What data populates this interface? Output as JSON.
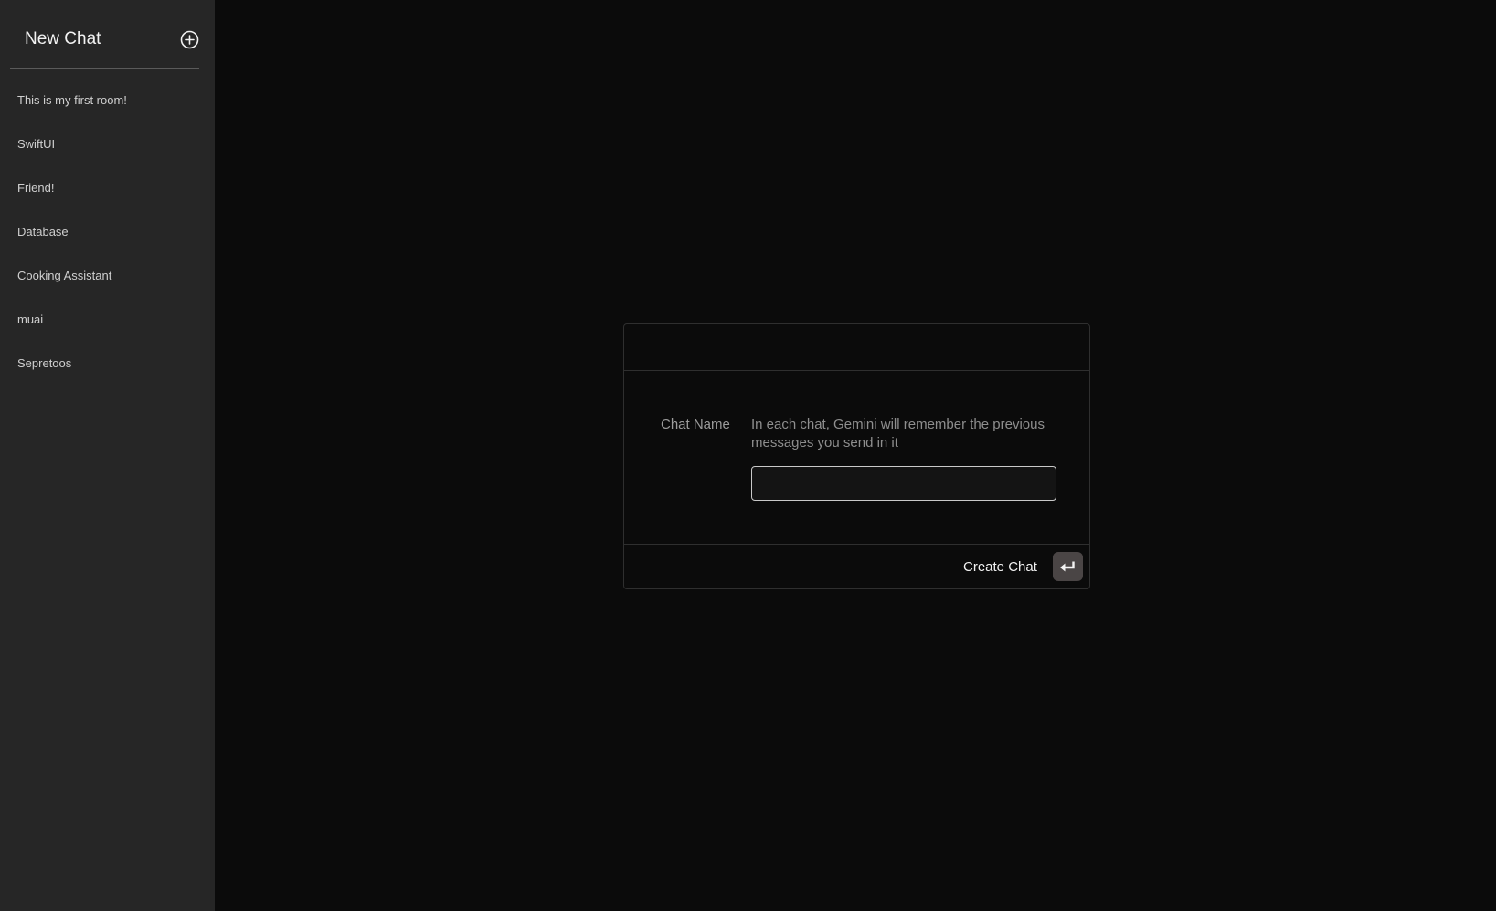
{
  "sidebar": {
    "title": "New Chat",
    "new_chat_icon": "plus-circle-icon",
    "items": [
      {
        "label": "This is my first room!"
      },
      {
        "label": "SwiftUI"
      },
      {
        "label": "Friend!"
      },
      {
        "label": "Database"
      },
      {
        "label": "Cooking Assistant"
      },
      {
        "label": "muai"
      },
      {
        "label": "Sepretoos"
      }
    ]
  },
  "dialog": {
    "field_label": "Chat Name",
    "field_help": "In each chat, Gemini will remember the previous messages you send in it",
    "input_value": "",
    "create_label": "Create Chat",
    "enter_icon": "return-enter-icon"
  },
  "colors": {
    "sidebar_bg": "#262626",
    "main_bg": "#0b0b0b",
    "enter_button_bg": "#4a4545"
  }
}
